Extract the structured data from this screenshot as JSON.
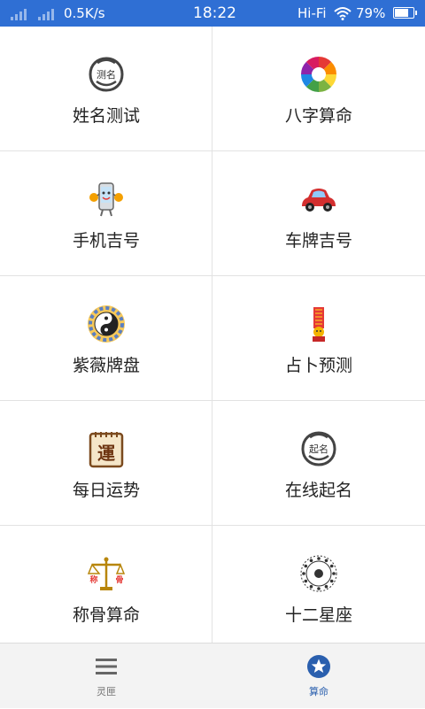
{
  "status_bar": {
    "network_speed": "0.5K/s",
    "time": "18:22",
    "network_type": "Hi-Fi",
    "battery_percent": "79%",
    "battery_level": 0.79,
    "background_color": "#2f6fd4"
  },
  "grid": {
    "items": [
      {
        "label": "姓名测试",
        "icon": "name-test-face-icon"
      },
      {
        "label": "八字算命",
        "icon": "color-wheel-icon"
      },
      {
        "label": "手机吉号",
        "icon": "phone-mascot-icon"
      },
      {
        "label": "车牌吉号",
        "icon": "red-car-icon"
      },
      {
        "label": "紫薇牌盘",
        "icon": "yin-yang-icon"
      },
      {
        "label": "占卜预测",
        "icon": "divination-figure-icon"
      },
      {
        "label": "每日运势",
        "icon": "fortune-calendar-icon"
      },
      {
        "label": "在线起名",
        "icon": "naming-face-icon"
      },
      {
        "label": "称骨算命",
        "icon": "bone-scale-icon"
      },
      {
        "label": "十二星座",
        "icon": "zodiac-wheel-icon"
      }
    ],
    "name_test_face_text": "测名",
    "naming_face_text": "起名",
    "fortune_calendar_char": "運",
    "bone_scale_left": "称",
    "bone_scale_right": "骨"
  },
  "bottom_nav": {
    "tabs": [
      {
        "label": "灵匣",
        "icon": "menu-lines-icon",
        "active": false
      },
      {
        "label": "算命",
        "icon": "star-circle-icon",
        "active": true
      }
    ],
    "active_color": "#2a5fae"
  }
}
